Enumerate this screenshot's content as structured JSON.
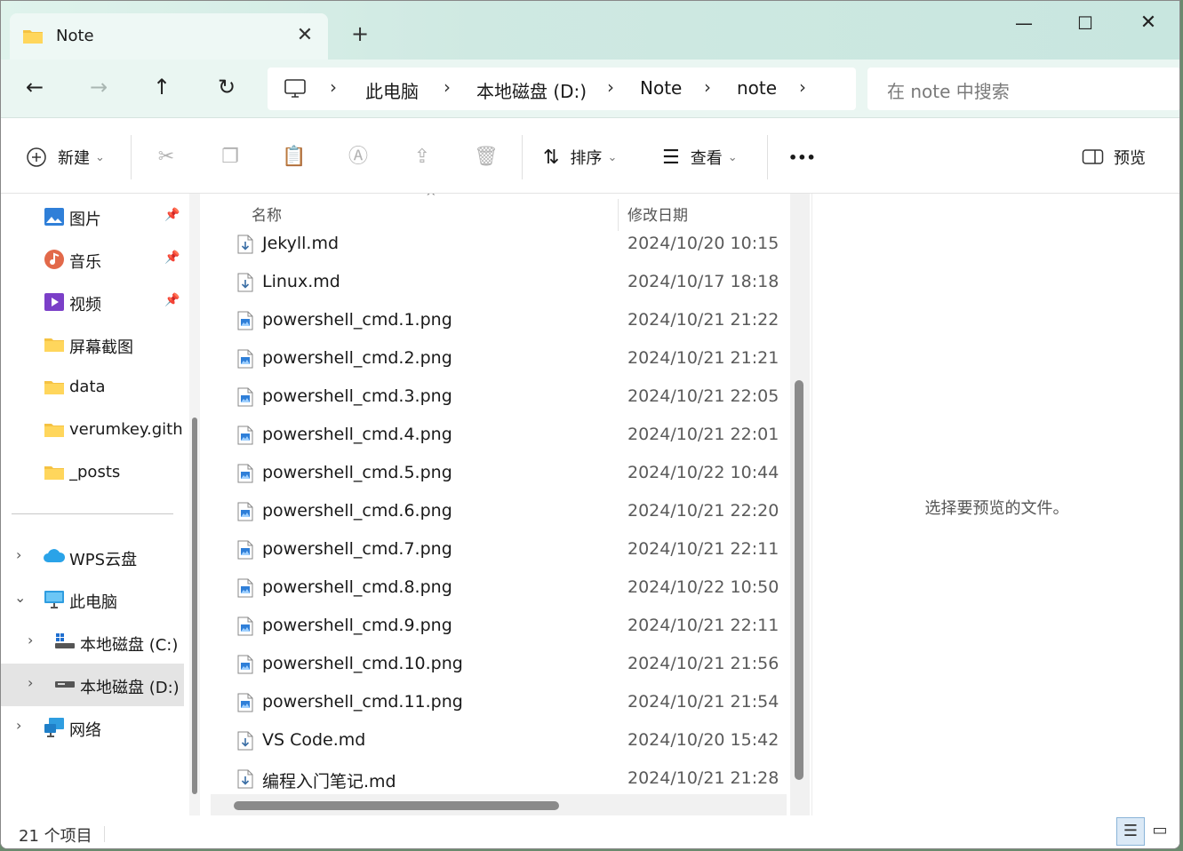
{
  "tab": {
    "title": "Note",
    "close": "✕",
    "new_tab": "+"
  },
  "window_controls": {
    "minimize": "—",
    "maximize": "☐",
    "close": "✕"
  },
  "nav": {
    "back": "←",
    "forward": "→",
    "up": "↑",
    "refresh": "↻",
    "chevron": "›"
  },
  "breadcrumb": [
    "此电脑",
    "本地磁盘 (D:)",
    "Note",
    "note"
  ],
  "search": {
    "placeholder": "在 note 中搜索"
  },
  "toolbar": {
    "new_label": "新建",
    "sort_label": "排序",
    "view_label": "查看",
    "more_label": "•••",
    "preview_label": "预览",
    "dropdown": "⌄"
  },
  "sidebar": {
    "items": [
      {
        "label": "图片",
        "icon": "pictures-icon",
        "pinned": true
      },
      {
        "label": "音乐",
        "icon": "music-icon",
        "pinned": true
      },
      {
        "label": "视频",
        "icon": "videos-icon",
        "pinned": true
      },
      {
        "label": "屏幕截图",
        "icon": "folder-icon"
      },
      {
        "label": "data",
        "icon": "folder-icon"
      },
      {
        "label": "verumkey.githu",
        "icon": "folder-icon"
      },
      {
        "label": "_posts",
        "icon": "folder-icon"
      },
      {
        "label": "WPS云盘",
        "icon": "cloud-icon"
      },
      {
        "label": "此电脑",
        "icon": "computer-icon"
      },
      {
        "label": "本地磁盘 (C:)",
        "icon": "drive-c-icon"
      },
      {
        "label": "本地磁盘 (D:)",
        "icon": "drive-d-icon"
      },
      {
        "label": "网络",
        "icon": "network-icon"
      }
    ],
    "pin_glyph": "📌",
    "expand_glyph": "›",
    "collapse_glyph": "⌄"
  },
  "columns": {
    "name": "名称",
    "modified": "修改日期",
    "sort_arrow": "^"
  },
  "files": [
    {
      "name": "Jekyll.md",
      "date": "2024/10/20 10:15",
      "type": "md"
    },
    {
      "name": "Linux.md",
      "date": "2024/10/17 18:18",
      "type": "md"
    },
    {
      "name": "powershell_cmd.1.png",
      "date": "2024/10/21 21:22",
      "type": "png"
    },
    {
      "name": "powershell_cmd.2.png",
      "date": "2024/10/21 21:21",
      "type": "png"
    },
    {
      "name": "powershell_cmd.3.png",
      "date": "2024/10/21 22:05",
      "type": "png"
    },
    {
      "name": "powershell_cmd.4.png",
      "date": "2024/10/21 22:01",
      "type": "png"
    },
    {
      "name": "powershell_cmd.5.png",
      "date": "2024/10/22 10:44",
      "type": "png"
    },
    {
      "name": "powershell_cmd.6.png",
      "date": "2024/10/21 22:20",
      "type": "png"
    },
    {
      "name": "powershell_cmd.7.png",
      "date": "2024/10/21 22:11",
      "type": "png"
    },
    {
      "name": "powershell_cmd.8.png",
      "date": "2024/10/22 10:50",
      "type": "png"
    },
    {
      "name": "powershell_cmd.9.png",
      "date": "2024/10/21 22:11",
      "type": "png"
    },
    {
      "name": "powershell_cmd.10.png",
      "date": "2024/10/21 21:56",
      "type": "png"
    },
    {
      "name": "powershell_cmd.11.png",
      "date": "2024/10/21 21:54",
      "type": "png"
    },
    {
      "name": "VS Code.md",
      "date": "2024/10/20 15:42",
      "type": "md"
    },
    {
      "name": "编程入门笔记.md",
      "date": "2024/10/21 21:28",
      "type": "md"
    }
  ],
  "preview_message": "选择要预览的文件。",
  "status": {
    "item_count": "21 个项目"
  },
  "colors": {
    "accent": "#0067c0",
    "folder": "#f5c242",
    "selected": "#e4e4e4"
  }
}
